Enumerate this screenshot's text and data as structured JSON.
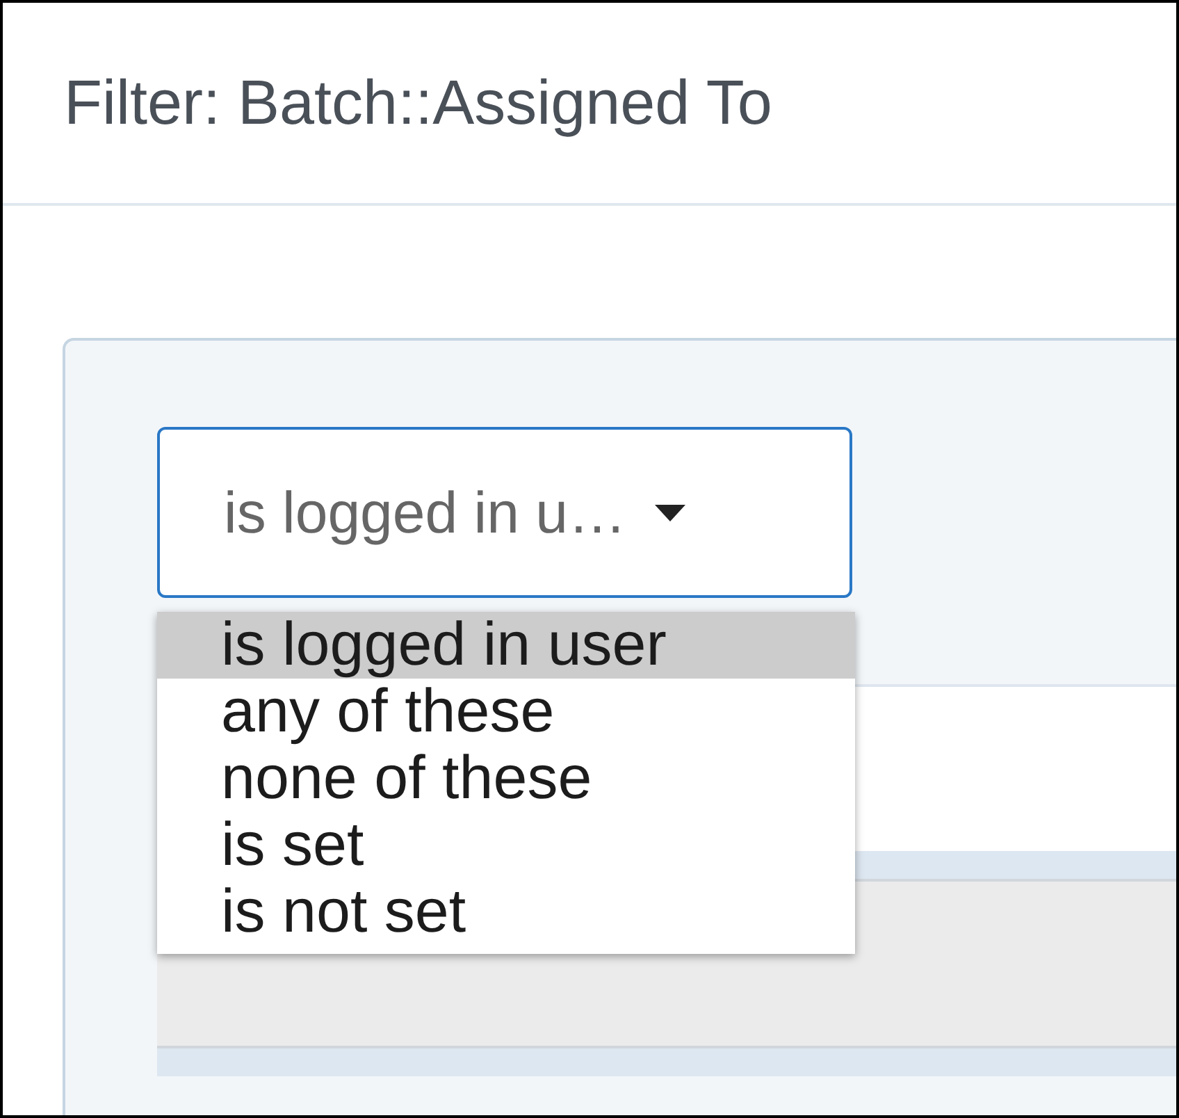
{
  "header": {
    "title": "Filter: Batch::Assigned To"
  },
  "filter": {
    "select": {
      "value": "is logged in u…",
      "expanded": true
    },
    "options": [
      {
        "label": "is logged in user",
        "selected": true
      },
      {
        "label": "any of these",
        "selected": false
      },
      {
        "label": "none of these",
        "selected": false
      },
      {
        "label": "is set",
        "selected": false
      },
      {
        "label": "is not set",
        "selected": false
      }
    ]
  }
}
